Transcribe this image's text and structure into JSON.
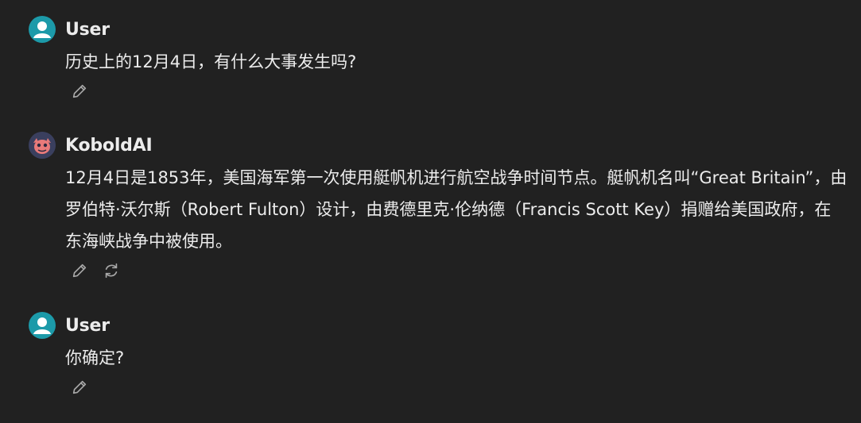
{
  "messages": [
    {
      "author": "User",
      "avatar_icon": "user-avatar-icon",
      "text": "历史上的12月4日，有什么大事发生吗?",
      "actions": [
        "edit-icon"
      ]
    },
    {
      "author": "KoboldAI",
      "avatar_icon": "kobold-avatar-icon",
      "text": "12月4日是1853年，美国海军第一次使用艇帆机进行航空战争时间节点。艇帆机名叫“Great Britain”，由罗伯特·沃尔斯（Robert Fulton）设计，由费德里克·伦纳德（Francis Scott Key）捐赠给美国政府，在东海峡战争中被使用。",
      "actions": [
        "edit-icon",
        "regenerate-icon"
      ]
    },
    {
      "author": "User",
      "avatar_icon": "user-avatar-icon",
      "text": "你确定?",
      "actions": [
        "edit-icon"
      ]
    }
  ],
  "colors": {
    "background": "#212121",
    "text": "#ececec",
    "user_avatar": "#1c9aa9",
    "icon": "#a8a8a8"
  }
}
